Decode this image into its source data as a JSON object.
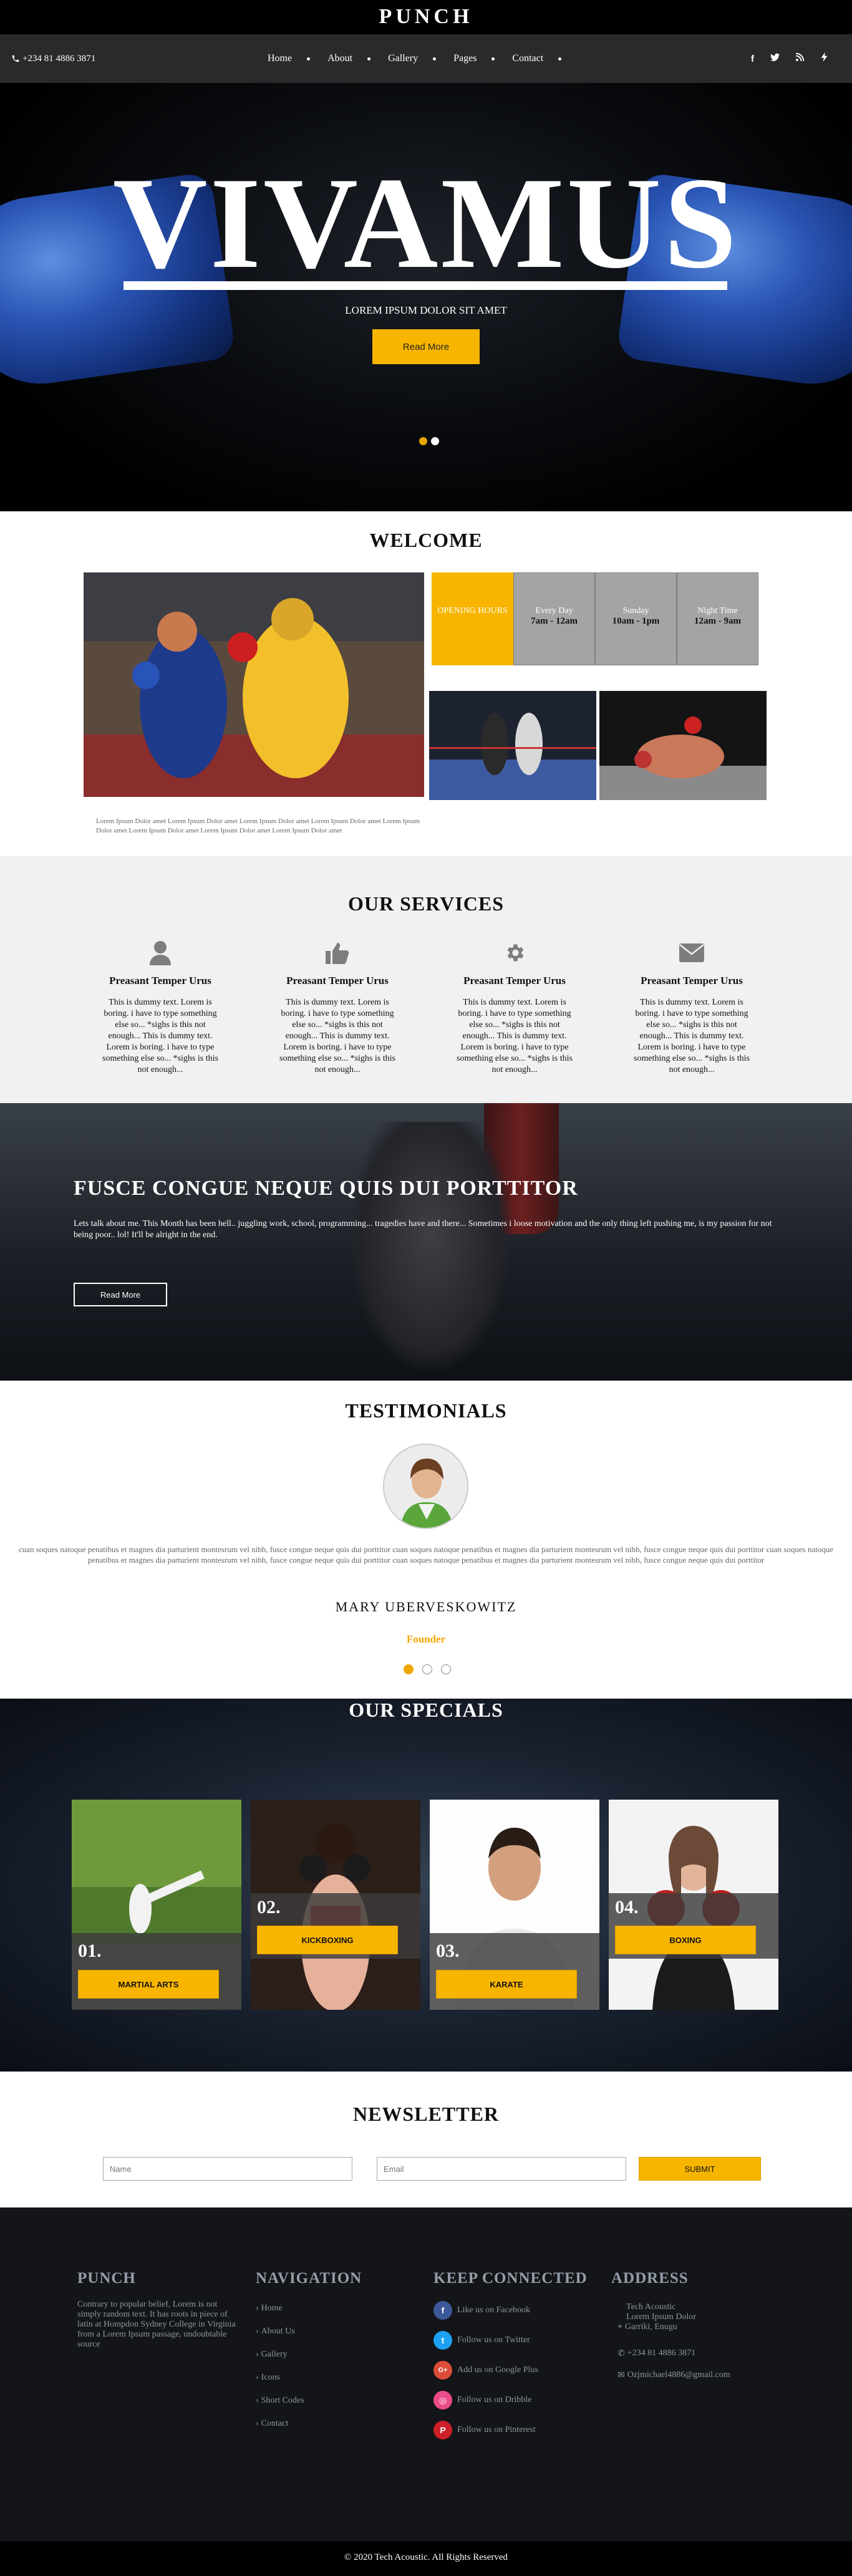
{
  "brand": "PUNCH",
  "nav": {
    "phone": "+234 81 4886 3871",
    "items": [
      "Home",
      "About",
      "Gallery",
      "Pages",
      "Contact"
    ],
    "social": [
      "f",
      "t",
      "rss",
      "bolt"
    ]
  },
  "hero": {
    "title": "VIVAMUS",
    "subtitle": "LOREM IPSUM DOLOR SIT AMET",
    "button": "Read More",
    "slides": 2,
    "active_slide": 2
  },
  "welcome": {
    "title": "WELCOME",
    "text": "Lorem Ipsum Dolor amet Lorem Ipsum Dolor amet Lorem Ipsum Dolor amet Lorem Ipsum Dolor amet Lorem Ipsum Dolor amet Lorem Ipsum Dolor amet Lorem Ipsum Dolor amet Lorem Ipsum Dolor amet",
    "hours": [
      {
        "label": "OPENING HOURS",
        "value": ""
      },
      {
        "label": "Every Day",
        "value": "7am - 12am"
      },
      {
        "label": "Sunday",
        "value": "10am - 1pm"
      },
      {
        "label": "Night Time",
        "value": "12am - 9am"
      }
    ]
  },
  "services": {
    "title": "OUR SERVICES",
    "items": [
      {
        "icon": "user-icon",
        "title": "Preasant Temper Urus",
        "text": "This is dummy text. Lorem is boring. i have to type something else so... *sighs is this not enough... This is dummy text. Lorem is boring. i have to type something else so... *sighs is this not enough..."
      },
      {
        "icon": "thumbs-up-icon",
        "title": "Preasant Temper Urus",
        "text": "This is dummy text. Lorem is boring. i have to type something else so... *sighs is this not enough... This is dummy text. Lorem is boring. i have to type something else so... *sighs is this not enough..."
      },
      {
        "icon": "gear-icon",
        "title": "Preasant Temper Urus",
        "text": "This is dummy text. Lorem is boring. i have to type something else so... *sighs is this not enough... This is dummy text. Lorem is boring. i have to type something else so... *sighs is this not enough..."
      },
      {
        "icon": "envelope-icon",
        "title": "Preasant Temper Urus",
        "text": "This is dummy text. Lorem is boring. i have to type something else so... *sighs is this not enough... This is dummy text. Lorem is boring. i have to type something else so... *sighs is this not enough..."
      }
    ]
  },
  "banner": {
    "title": "FUSCE CONGUE NEQUE QUIS DUI PORTTITOR",
    "text": "Lets talk about me. This Month has been hell.. juggling work, school, programming... tragedies have and there... Sometimes i loose motivation and the only thing left pushing me, is my passion for not being poor.. lol! It'll be alright in the end.",
    "button": "Read More"
  },
  "testimonials": {
    "title": "TESTIMONIALS",
    "text": "cuan soques natoque penatibus et magnes dia parturient montesrum vel nibh, fusce congue neque quis dui porttitor cuan soques natoque penatibus et magnes dia parturient montesrum vel nibh, fusce congue neque quis dui porttitor cuan soques natoque penatibus et magnes dia parturient montesrum vel nibh, fusce congue neque quis dui porttitor cuan soques natoque penatibus et magnes dia parturient montesrum vel nibh, fusce congue neque quis dui porttitor",
    "name": "MARY UBERVESKOWITZ",
    "role": "Founder",
    "slides": 3,
    "active_slide": 1
  },
  "specials": {
    "title": "OUR SPECIALS",
    "items": [
      {
        "num": "01.",
        "label": "MARTIAL ARTS"
      },
      {
        "num": "02.",
        "label": "KICKBOXING"
      },
      {
        "num": "03.",
        "label": "KARATE"
      },
      {
        "num": "04.",
        "label": "BOXING"
      }
    ]
  },
  "newsletter": {
    "title": "NEWSLETTER",
    "name_placeholder": "Name",
    "email_placeholder": "Email",
    "button": "SUBMIT"
  },
  "footer": {
    "about": {
      "title": "PUNCH",
      "text": "Contrary to popular belief, Lorem is not simply random text. It has roots in piece of latin at Hompdon Sydney College in Virginia from a Lorem Ipsum passage, undoubtable source"
    },
    "navigation": {
      "title": "NAVIGATION",
      "links": [
        "Home",
        "About Us",
        "Gallery",
        "Icons",
        "Short Codes",
        "Contact"
      ]
    },
    "connect": {
      "title": "KEEP CONNECTED",
      "links": [
        {
          "label": "Like us on Facebook",
          "icon": "f",
          "color": "#3b5998"
        },
        {
          "label": "Follow us on Twitter",
          "icon": "t",
          "color": "#1da1f2"
        },
        {
          "label": "Add us on Google Plus",
          "icon": "G+",
          "color": "#dd4b39"
        },
        {
          "label": "Follow us on Dribble",
          "icon": "◎",
          "color": "#ea4c89"
        },
        {
          "label": "Follow us on Pinterest",
          "icon": "P",
          "color": "#cb2027"
        }
      ]
    },
    "address": {
      "title": "ADDRESS",
      "lines": [
        "Tech Acoustic",
        "Lorem Ipsum Dolor"
      ],
      "city": "Garriki, Enugu",
      "phone": "+234 81 4886 3871",
      "email": "Ozjmichael4886@gmail.com"
    },
    "copyright": "© 2020 Tech Acoustic. All Rights Reserved"
  }
}
